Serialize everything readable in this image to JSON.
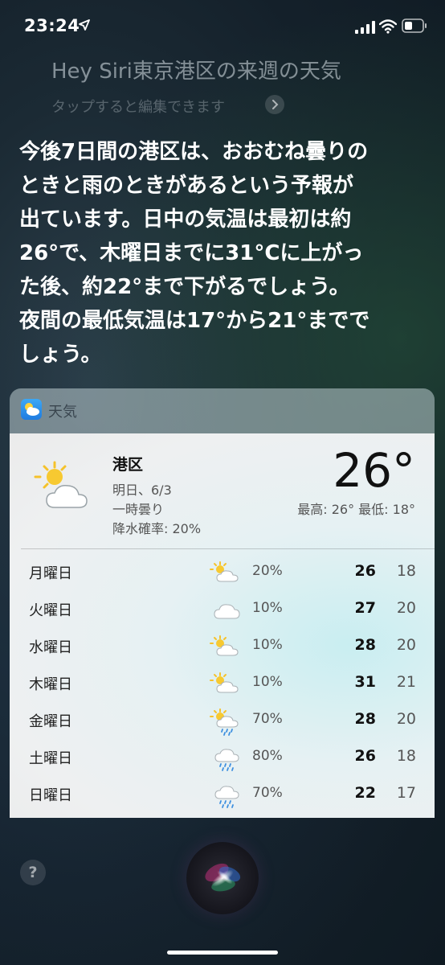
{
  "status_bar": {
    "time": "23:24"
  },
  "siri": {
    "query": "Hey Siri東京港区の来週の天気",
    "tap_to_edit": "タップすると編集できます",
    "answer_lines": [
      "今後7日間の港区は、おおむね曇りの",
      "ときと雨のときがあるという予報が",
      "出ています。日中の気温は最初は約",
      "26°で、木曜日までに31°Cに上がっ",
      "た後、約22°まで下がるでしょう。",
      "夜間の最低気温は17°から21°までで",
      "しょう。"
    ]
  },
  "card": {
    "app_name": "天気",
    "location": "港区",
    "date": "明日、6/3",
    "condition": "一時曇り",
    "rain_chance": "降水確率: 20%",
    "current_temp": "26°",
    "hi_lo": "最高: 26° 最低: 18°",
    "forecast": [
      {
        "day": "月曜日",
        "icon": "partly-cloudy-icon",
        "pct": "20%",
        "hi": "26",
        "lo": "18"
      },
      {
        "day": "火曜日",
        "icon": "cloud-icon",
        "pct": "10%",
        "hi": "27",
        "lo": "20"
      },
      {
        "day": "水曜日",
        "icon": "partly-cloudy-icon",
        "pct": "10%",
        "hi": "28",
        "lo": "20"
      },
      {
        "day": "木曜日",
        "icon": "partly-cloudy-icon",
        "pct": "10%",
        "hi": "31",
        "lo": "21"
      },
      {
        "day": "金曜日",
        "icon": "sun-rain-icon",
        "pct": "70%",
        "hi": "28",
        "lo": "20"
      },
      {
        "day": "土曜日",
        "icon": "rain-cloud-icon",
        "pct": "80%",
        "hi": "26",
        "lo": "18"
      },
      {
        "day": "日曜日",
        "icon": "rain-cloud-icon",
        "pct": "70%",
        "hi": "22",
        "lo": "17"
      }
    ]
  },
  "help_label": "?"
}
